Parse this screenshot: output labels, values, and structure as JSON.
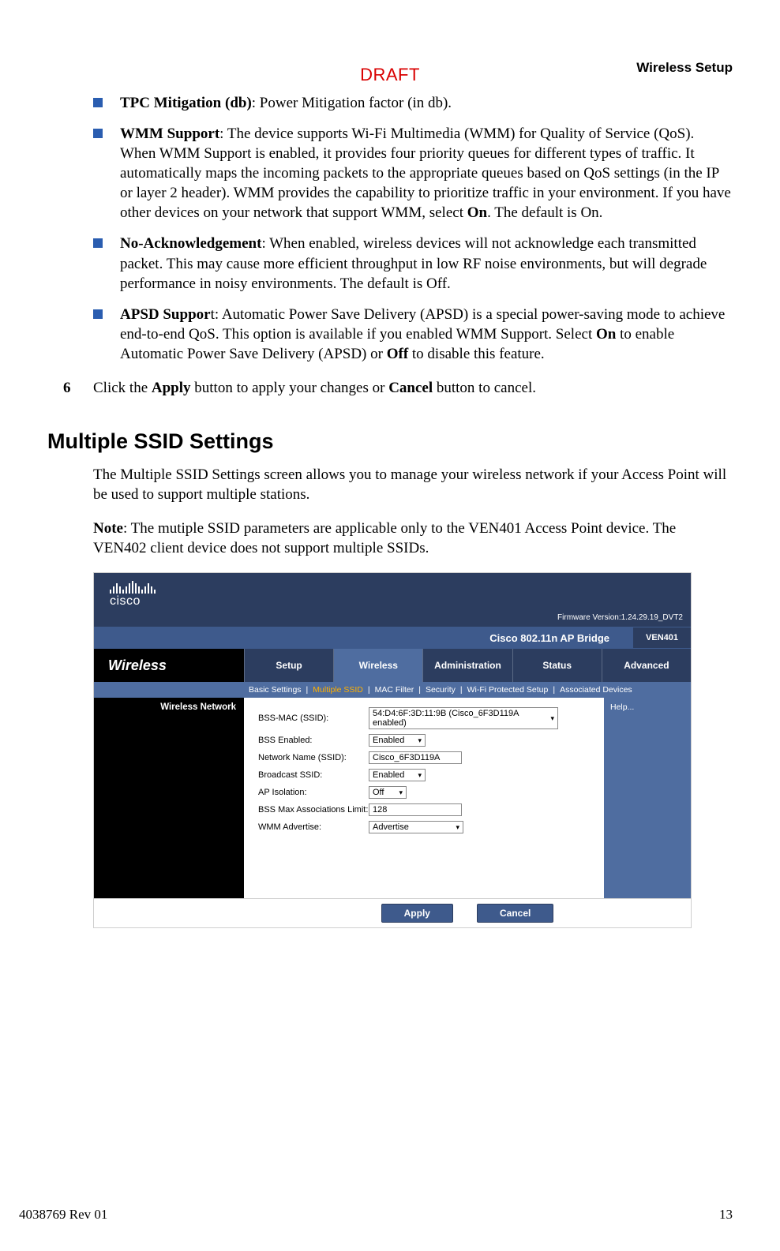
{
  "watermark": "DRAFT",
  "section_label": "Wireless Setup",
  "bullets": [
    {
      "label": "TPC Mitigation (db)",
      "rest": ": Power Mitigation factor (in db)."
    },
    {
      "label": "WMM Support",
      "rest": ": The device supports Wi-Fi Multimedia (WMM) for Quality of Service (QoS). When WMM Support is enabled, it provides four priority queues for different types of traffic. It automatically maps the incoming packets to the appropriate queues based on QoS settings (in the IP or layer 2 header). WMM provides the capability to prioritize traffic in your environment. If you have other devices on your network that support WMM, select ",
      "bold2": "On",
      "tail": ". The default is On."
    },
    {
      "label": "No-Acknowledgement",
      "rest": ": When enabled, wireless devices will not acknowledge each transmitted packet. This may cause more efficient throughput in low RF noise environments, but will degrade performance in noisy environments. The default is Off."
    },
    {
      "label": "APSD Suppor",
      "label_tail": "t",
      "rest": ": Automatic Power Save Delivery (APSD) is a special power-saving mode to achieve end-to-end QoS. This option is available if you enabled WMM Support. Select ",
      "bold2": "On",
      "mid": " to enable Automatic Power Save Delivery (APSD) or ",
      "bold3": "Off",
      "tail": " to disable this feature."
    }
  ],
  "step6": {
    "num": "6",
    "a": "Click the ",
    "b1": "Apply",
    "b": " button to apply your changes or ",
    "b2": "Cancel",
    "c": " button to cancel."
  },
  "heading": "Multiple SSID Settings",
  "para1": "The Multiple SSID Settings screen allows you to manage your wireless network if your Access Point will be used to support multiple stations.",
  "note_label": "Note",
  "note_rest": ": The mutiple SSID parameters are applicable only to the VEN401 Access Point device. The VEN402 client device does not support multiple SSIDs.",
  "ui": {
    "cisco": "cisco",
    "fw": "Firmware Version:1.24.29.19_DVT2",
    "product": "Cisco 802.11n AP Bridge",
    "model": "VEN401",
    "nav_left": "Wireless",
    "tabs": [
      "Setup",
      "Wireless",
      "Administration",
      "Status",
      "Advanced"
    ],
    "subtabs": [
      "Basic Settings",
      "Multiple SSID",
      "MAC Filter",
      "Security",
      "Wi-Fi Protected Setup",
      "Associated Devices"
    ],
    "side_section": "Wireless Network",
    "help": "Help...",
    "form": {
      "bss_mac_label": "BSS-MAC (SSID):",
      "bss_mac_value": "54:D4:6F:3D:11:9B (Cisco_6F3D119A enabled)",
      "bss_enabled_label": "BSS Enabled:",
      "bss_enabled_value": "Enabled",
      "ssid_label": "Network Name (SSID):",
      "ssid_value": "Cisco_6F3D119A",
      "broadcast_label": "Broadcast SSID:",
      "broadcast_value": "Enabled",
      "ap_iso_label": "AP Isolation:",
      "ap_iso_value": "Off",
      "assoc_label": "BSS Max Associations Limit:",
      "assoc_value": "128",
      "wmm_label": "WMM Advertise:",
      "wmm_value": "Advertise"
    },
    "apply": "Apply",
    "cancel": "Cancel"
  },
  "footer_left": "4038769 Rev 01",
  "footer_right": "13"
}
